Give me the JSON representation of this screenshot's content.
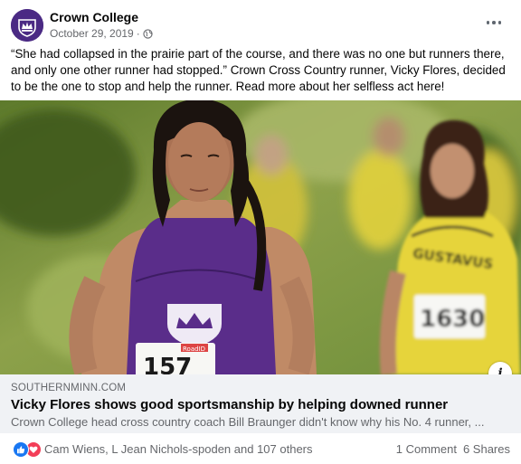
{
  "post": {
    "page_name": "Crown College",
    "date": "October 29, 2019",
    "separator": "·",
    "privacy_icon": "globe-icon",
    "text": "“She had collapsed in the prairie part of the course, and there was no one but runners there, and only one other runner had stopped.” Crown Cross Country runner, Vicky Flores, decided to be the one to stop and help the runner. Read more about her selfless act here!"
  },
  "photo": {
    "bib_left": "157",
    "bib_right": "1630",
    "jersey_right": "GUSTAVUS",
    "bib_brand": "RoadID"
  },
  "link": {
    "domain": "SOUTHERNMINN.COM",
    "title": "Vicky Flores shows good sportsmanship by helping downed runner",
    "description": "Crown College head cross country coach Bill Braunger didn't know why his No. 4 runner, ..."
  },
  "footer": {
    "reactors": "Cam Wiens, L Jean Nichols-spoden and 107 others",
    "comments": "1 Comment",
    "shares": "6 Shares",
    "reaction_icons": [
      "like-icon",
      "love-icon"
    ]
  },
  "colors": {
    "brand_purple": "#4b2a84",
    "like_blue": "#1877f2",
    "love_red": "#f33e58",
    "meta_gray": "#65676b"
  }
}
